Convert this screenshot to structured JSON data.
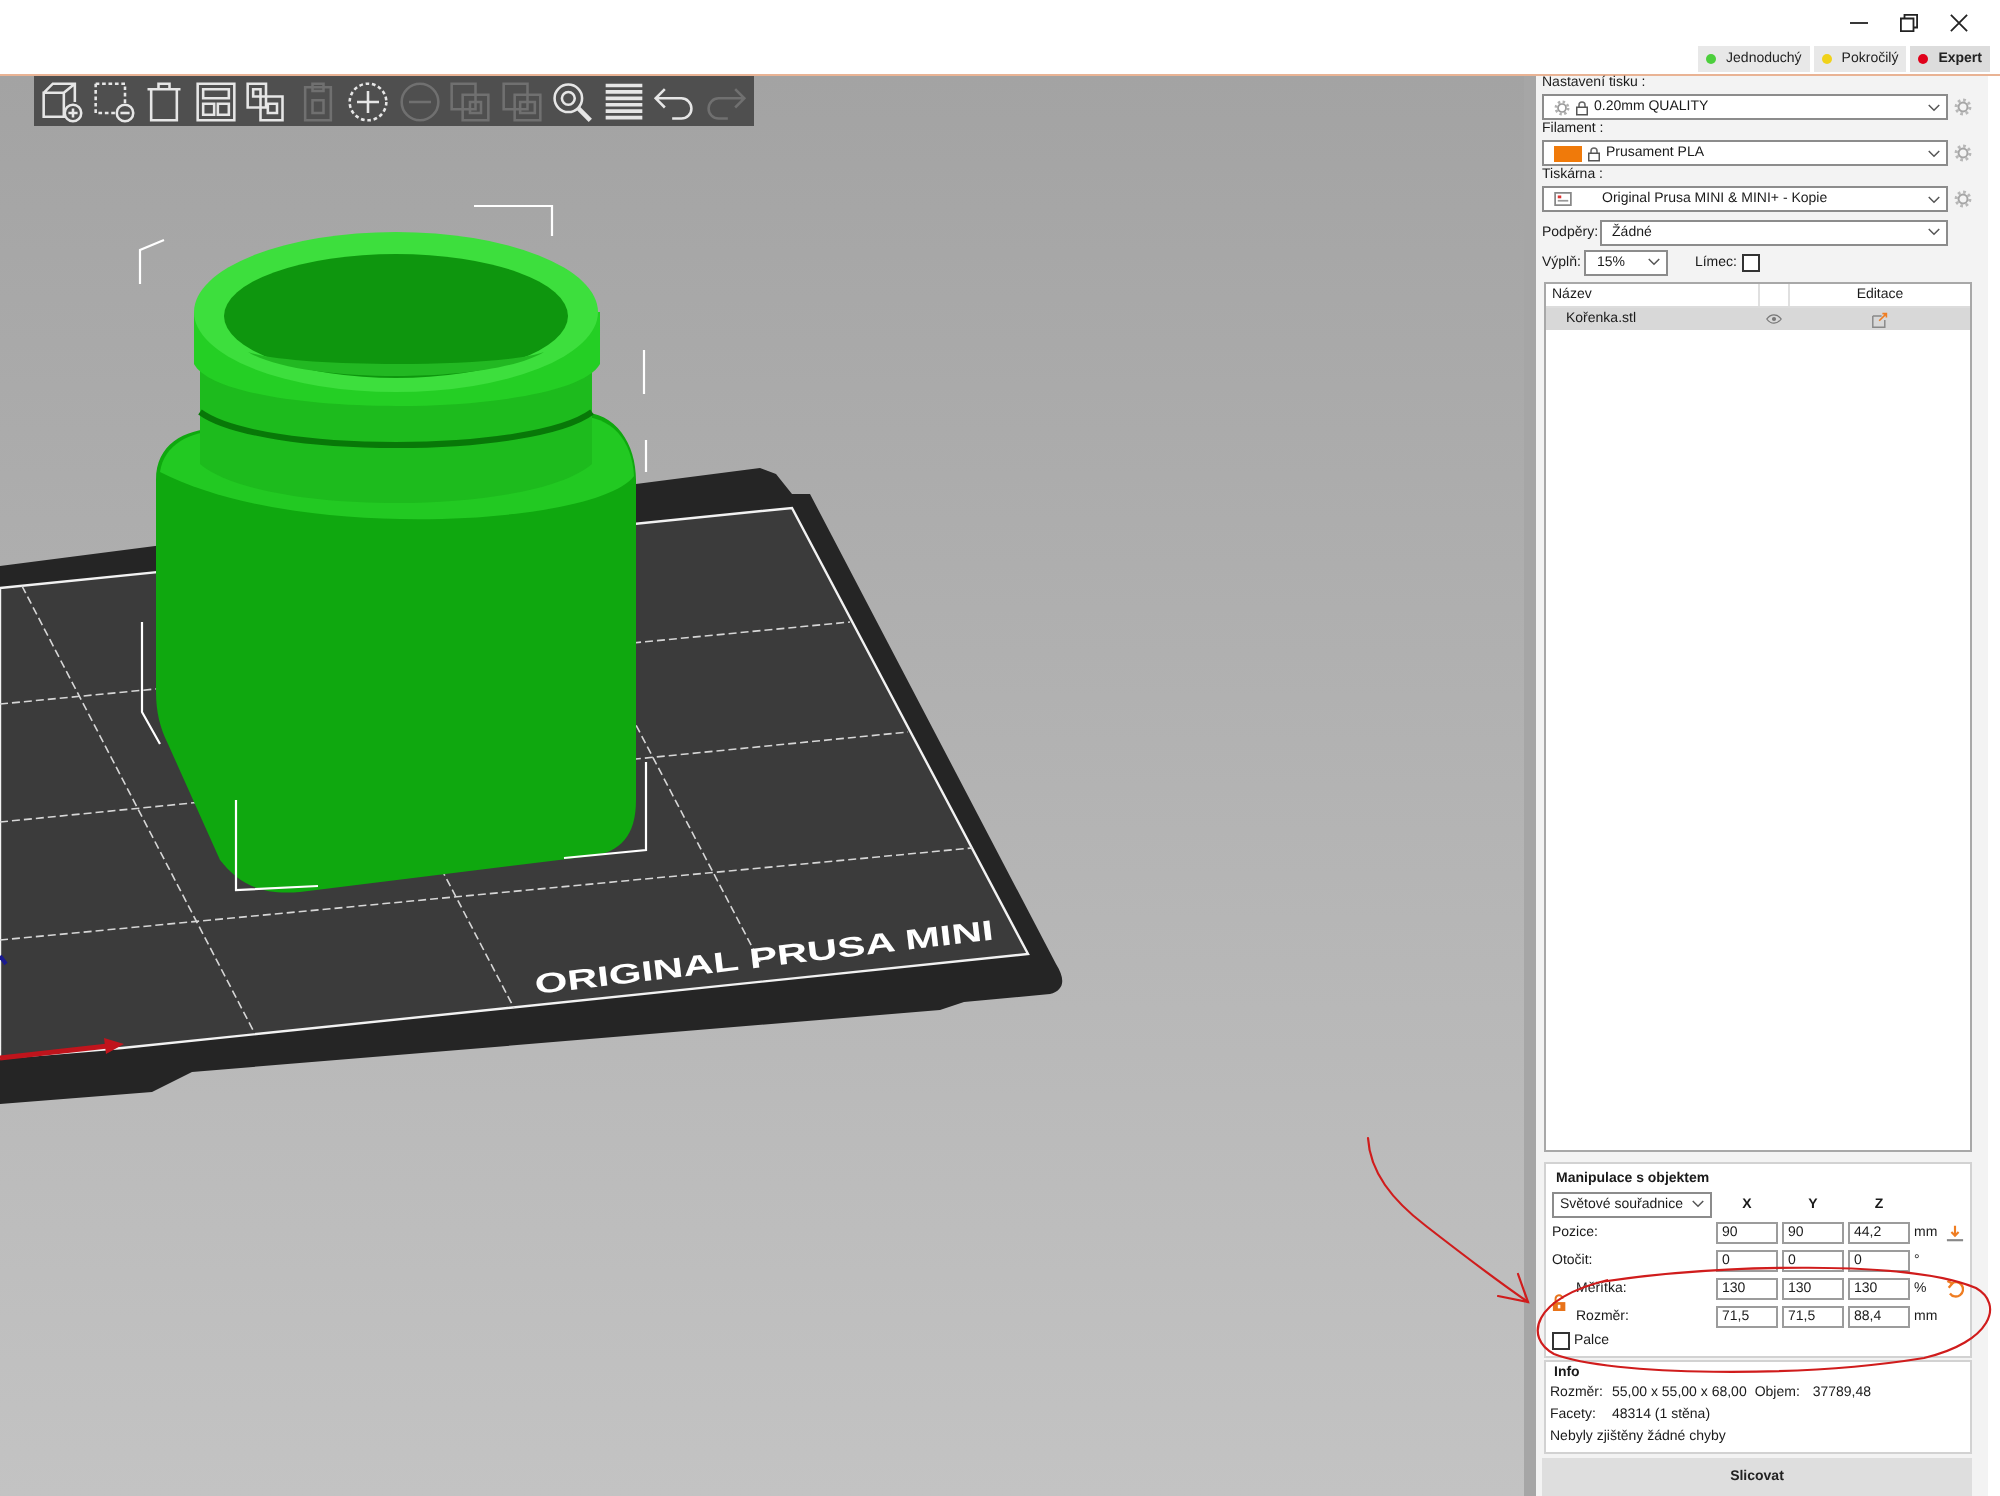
{
  "modes": [
    {
      "label": "Jednoduchý",
      "color": "#4ccf3c",
      "selected": false
    },
    {
      "label": "Pokročilý",
      "color": "#f0d21a",
      "selected": false
    },
    {
      "label": "Expert",
      "color": "#e0001a",
      "selected": true
    }
  ],
  "toolbar": [
    {
      "kind": "add",
      "disabled": false
    },
    {
      "kind": "remove",
      "disabled": false
    },
    {
      "kind": "trash",
      "disabled": false
    },
    {
      "kind": "arrange",
      "disabled": false
    },
    {
      "kind": "copy",
      "disabled": false
    },
    {
      "kind": "paste",
      "disabled": true
    },
    {
      "kind": "plus",
      "disabled": false
    },
    {
      "kind": "minus",
      "disabled": true
    },
    {
      "kind": "splitobjects",
      "disabled": true
    },
    {
      "kind": "splitparts",
      "disabled": true
    },
    {
      "kind": "search",
      "disabled": false
    },
    {
      "kind": "layers",
      "disabled": false
    },
    {
      "kind": "undo",
      "disabled": false
    },
    {
      "kind": "redo",
      "disabled": true
    }
  ],
  "viewport": {
    "bed_label": "ORIGINAL PRUSA MINI"
  },
  "sidebar": {
    "presets": [
      {
        "kind": "print",
        "label": "Nastavení tisku :",
        "value": "0.20mm QUALITY"
      },
      {
        "kind": "filament",
        "label": "Filament :",
        "value": "Prusament PLA",
        "color": "#f07a0a"
      },
      {
        "kind": "printer",
        "label": "Tiskárna :",
        "value": "Original Prusa MINI & MINI+ - Kopie"
      }
    ],
    "supports": {
      "label": "Podpěry:",
      "value": "Žádné"
    },
    "infill": {
      "label": "Výplň:",
      "value": "15%"
    },
    "brim": {
      "label": "Límec:",
      "checked": false
    },
    "objects": {
      "columns": [
        "Název",
        "Editace"
      ],
      "rows": [
        {
          "name": "Kořenka.stl",
          "selected": true
        }
      ]
    },
    "manipulation": {
      "title": "Manipulace s objektem",
      "coordinates": "Světové souřadnice",
      "axes": [
        "X",
        "Y",
        "Z"
      ],
      "rows": [
        {
          "kind": "position",
          "label": "Pozice:",
          "values": [
            "90",
            "90",
            "44,2"
          ],
          "unit": "mm"
        },
        {
          "kind": "rotation",
          "label": "Otočit:",
          "values": [
            "0",
            "0",
            "0"
          ],
          "unit": "°"
        },
        {
          "kind": "scale",
          "label": "Měřítka:",
          "values": [
            "130",
            "130",
            "130"
          ],
          "unit": "%"
        },
        {
          "kind": "size",
          "label": "Rozměr:",
          "values": [
            "71,5",
            "71,5",
            "88,4"
          ],
          "unit": "mm"
        }
      ],
      "inches": {
        "label": "Palce",
        "checked": false
      }
    },
    "info": {
      "title": "Info",
      "size_label": "Rozměr:",
      "size": "55,00 x 55,00 x 68,00",
      "volume_label": "Objem:",
      "volume": "37789,48",
      "facets_label": "Facety:",
      "facets": "48314 (1 stěna)",
      "errors": "Nebyly zjištěny žádné chyby"
    },
    "slice_button": "Slicovat"
  }
}
